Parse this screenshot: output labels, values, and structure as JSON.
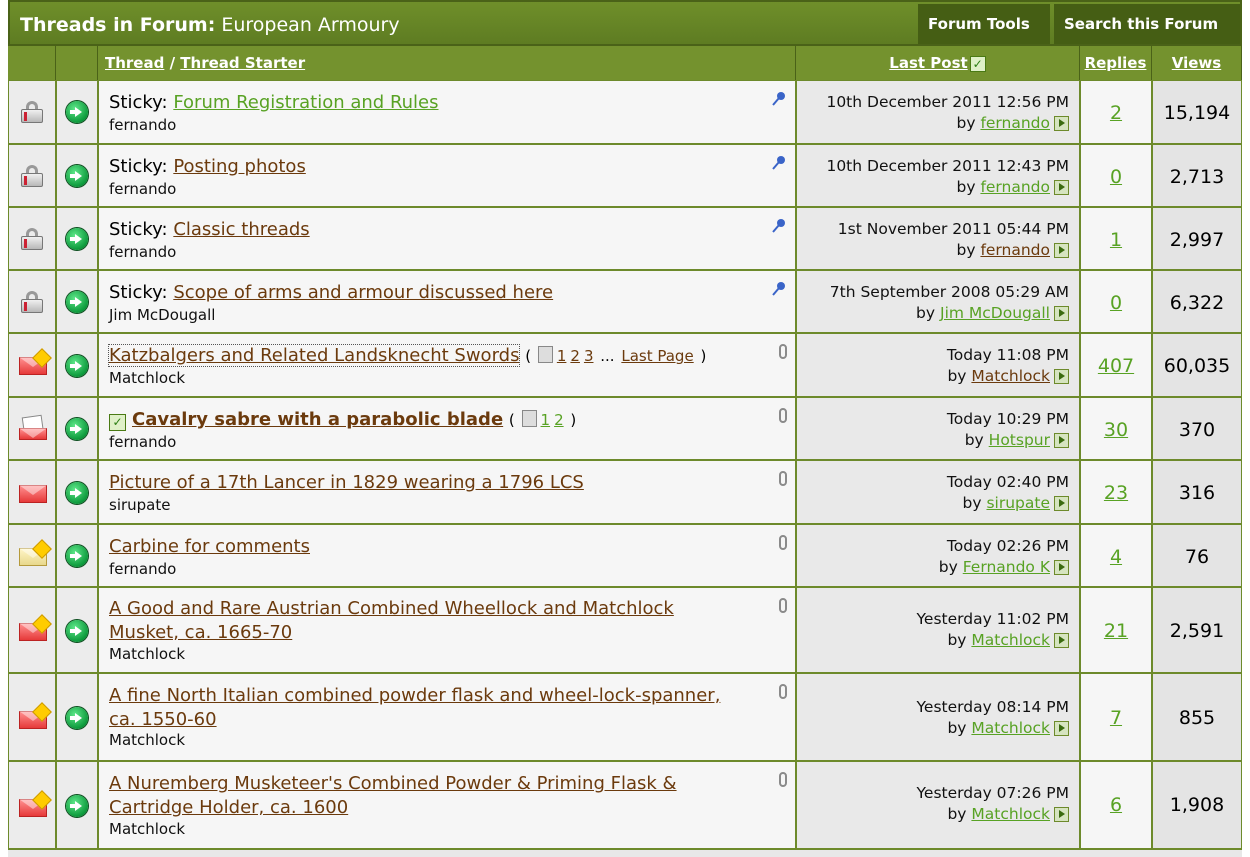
{
  "header": {
    "title_bold": "Threads in Forum",
    "title_colon": ":",
    "forum_name": "European Armoury",
    "forum_tools": "Forum Tools",
    "search_forum": "Search this Forum"
  },
  "columns": {
    "thread": "Thread",
    "slash": "/",
    "thread_starter": "Thread Starter",
    "last_post": "Last Post",
    "replies": "Replies",
    "views": "Views"
  },
  "threads": [
    {
      "prefix": "Sticky:",
      "title": "Forum Registration and Rules",
      "starter": "fernando",
      "date": "10th December 2011 12:56 PM",
      "by": "by",
      "last_user": "fernando",
      "replies": "2",
      "views": "15,194"
    },
    {
      "prefix": "Sticky:",
      "title": "Posting photos",
      "starter": "fernando",
      "date": "10th December 2011 12:43 PM",
      "by": "by",
      "last_user": "fernando",
      "replies": "0",
      "views": "2,713"
    },
    {
      "prefix": "Sticky:",
      "title": "Classic threads",
      "starter": "fernando",
      "date": "1st November 2011 05:44 PM",
      "by": "by",
      "last_user": "fernando",
      "replies": "1",
      "views": "2,997"
    },
    {
      "prefix": "Sticky:",
      "title": "Scope of arms and armour discussed here",
      "starter": "Jim McDougall",
      "date": "7th September 2008 05:29 AM",
      "by": "by",
      "last_user": "Jim McDougall",
      "replies": "0",
      "views": "6,322"
    },
    {
      "title": "Katzbalgers and Related Landsknecht Swords",
      "starter": "Matchlock",
      "pages_open": "(",
      "pages": [
        "1",
        "2",
        "3"
      ],
      "ellipsis": "...",
      "last_page": "Last Page",
      "pages_close": ")",
      "date": "Today 11:08 PM",
      "by": "by",
      "last_user": "Matchlock",
      "replies": "407",
      "views": "60,035"
    },
    {
      "title": "Cavalry sabre with a parabolic blade",
      "starter": "fernando",
      "pages_open": "(",
      "pages": [
        "1",
        "2"
      ],
      "pages_close": ")",
      "date": "Today 10:29 PM",
      "by": "by",
      "last_user": "Hotspur",
      "replies": "30",
      "views": "370"
    },
    {
      "title": "Picture of a 17th Lancer in 1829 wearing a 1796 LCS",
      "starter": "sirupate",
      "date": "Today 02:40 PM",
      "by": "by",
      "last_user": "sirupate",
      "replies": "23",
      "views": "316"
    },
    {
      "title": "Carbine for comments",
      "starter": "fernando",
      "date": "Today 02:26 PM",
      "by": "by",
      "last_user": "Fernando K",
      "replies": "4",
      "views": "76"
    },
    {
      "title_line1": "A Good and Rare Austrian Combined Wheellock and Matchlock",
      "title_line2": "Musket, ca. 1665-70",
      "starter": "Matchlock",
      "date": "Yesterday 11:02 PM",
      "by": "by",
      "last_user": "Matchlock",
      "replies": "21",
      "views": "2,591"
    },
    {
      "title_line1": "A fine North Italian combined powder flask and wheel-lock-spanner,",
      "title_line2": "ca. 1550-60",
      "starter": "Matchlock",
      "date": "Yesterday 08:14 PM",
      "by": "by",
      "last_user": "Matchlock",
      "replies": "7",
      "views": "855"
    },
    {
      "title_line1": "A Nuremberg Musketeer's Combined Powder & Priming Flask &",
      "title_line2": "Cartridge Holder, ca. 1600",
      "starter": "Matchlock",
      "date": "Yesterday 07:26 PM",
      "by": "by",
      "last_user": "Matchlock",
      "replies": "6",
      "views": "1,908"
    }
  ],
  "icons": {
    "status_locked": "lock-icon",
    "status_hot": "hot-envelope-icon",
    "go_first_new": "go-to-first-new-post-icon",
    "sticky": "pin-icon",
    "attachment": "paperclip-icon",
    "go_last": "go-to-last-post-icon"
  },
  "colors": {
    "bar_green": "#6d8a2b",
    "link_brown": "#6b3a0d",
    "link_green": "#58a224"
  }
}
